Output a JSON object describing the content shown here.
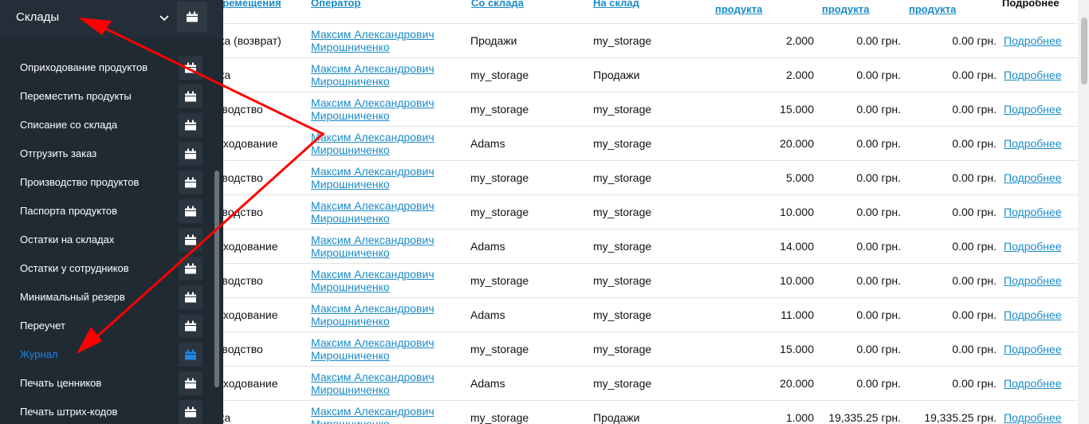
{
  "sidebar": {
    "title": "Склады",
    "chevron_icon": "chevron-down-icon",
    "button_icon": "calendar-icon",
    "accent_color": "#1e88e5",
    "items": [
      {
        "label": "Оприходование продуктов"
      },
      {
        "label": "Переместить продукты"
      },
      {
        "label": "Списание со склада"
      },
      {
        "label": "Отгрузить заказ"
      },
      {
        "label": "Производство продуктов"
      },
      {
        "label": "Паспорта продуктов"
      },
      {
        "label": "Остатки на складах"
      },
      {
        "label": "Остатки у сотрудников"
      },
      {
        "label": "Минимальный резерв"
      },
      {
        "label": "Переучет"
      },
      {
        "label": "Журнал",
        "active": true
      },
      {
        "label": "Печать ценников"
      },
      {
        "label": "Печать штрих-кодов"
      }
    ]
  },
  "table": {
    "link_color": "#1a8bc9",
    "columns": [
      {
        "label": "еремещения"
      },
      {
        "label": "Оператор"
      },
      {
        "label": "Со склада"
      },
      {
        "label": "На склад"
      },
      {
        "label": "продукта"
      },
      {
        "label": "продукта"
      },
      {
        "label": "продукта"
      },
      {
        "label": "Подробнее"
      }
    ],
    "rows": [
      {
        "type": "жа (возврат)",
        "op1": "Максим Александрович",
        "op2": "Мирошниченко",
        "from": "Продажи",
        "to": "my_storage",
        "qty": "2.000",
        "p1": "0.00 грн.",
        "p2": "0.00 грн.",
        "more": "Подробнее"
      },
      {
        "type": "жа",
        "op1": "Максим Александрович",
        "op2": "Мирошниченко",
        "from": "my_storage",
        "to": "Продажи",
        "qty": "2.000",
        "p1": "0.00 грн.",
        "p2": "0.00 грн.",
        "more": "Подробнее"
      },
      {
        "type": "зводство",
        "op1": "Максим Александрович",
        "op2": "Мирошниченко",
        "from": "my_storage",
        "to": "my_storage",
        "qty": "15.000",
        "p1": "0.00 грн.",
        "p2": "0.00 грн.",
        "more": "Подробнее"
      },
      {
        "type": "иходование",
        "op1": "Максим Александрович",
        "op2": "Мирошниченко",
        "from": "Adams",
        "to": "my_storage",
        "qty": "20.000",
        "p1": "0.00 грн.",
        "p2": "0.00 грн.",
        "more": "Подробнее"
      },
      {
        "type": "зводство",
        "op1": "Максим Александрович",
        "op2": "Мирошниченко",
        "from": "my_storage",
        "to": "my_storage",
        "qty": "5.000",
        "p1": "0.00 грн.",
        "p2": "0.00 грн.",
        "more": "Подробнее"
      },
      {
        "type": "зводство",
        "op1": "Максим Александрович",
        "op2": "Мирошниченко",
        "from": "my_storage",
        "to": "my_storage",
        "qty": "10.000",
        "p1": "0.00 грн.",
        "p2": "0.00 грн.",
        "more": "Подробнее"
      },
      {
        "type": "иходование",
        "op1": "Максим Александрович",
        "op2": "Мирошниченко",
        "from": "Adams",
        "to": "my_storage",
        "qty": "14.000",
        "p1": "0.00 грн.",
        "p2": "0.00 грн.",
        "more": "Подробнее"
      },
      {
        "type": "зводство",
        "op1": "Максим Александрович",
        "op2": "Мирошниченко",
        "from": "my_storage",
        "to": "my_storage",
        "qty": "10.000",
        "p1": "0.00 грн.",
        "p2": "0.00 грн.",
        "more": "Подробнее"
      },
      {
        "type": "иходование",
        "op1": "Максим Александрович",
        "op2": "Мирошниченко",
        "from": "Adams",
        "to": "my_storage",
        "qty": "11.000",
        "p1": "0.00 грн.",
        "p2": "0.00 грн.",
        "more": "Подробнее"
      },
      {
        "type": "зводство",
        "op1": "Максим Александрович",
        "op2": "Мирошниченко",
        "from": "my_storage",
        "to": "my_storage",
        "qty": "15.000",
        "p1": "0.00 грн.",
        "p2": "0.00 грн.",
        "more": "Подробнее"
      },
      {
        "type": "иходование",
        "op1": "Максим Александрович",
        "op2": "Мирошниченко",
        "from": "Adams",
        "to": "my_storage",
        "qty": "20.000",
        "p1": "0.00 грн.",
        "p2": "0.00 грн.",
        "more": "Подробнее"
      },
      {
        "type": "жа",
        "op1": "Максим Александрович",
        "op2": "Мирошниченко",
        "from": "my_storage",
        "to": "Продажи",
        "qty": "1.000",
        "p1": "19,335.25 грн.",
        "p2": "19,335.25 грн.",
        "more": "Подробнее"
      }
    ]
  },
  "annotation": {
    "arrow_color": "#ff0000"
  }
}
